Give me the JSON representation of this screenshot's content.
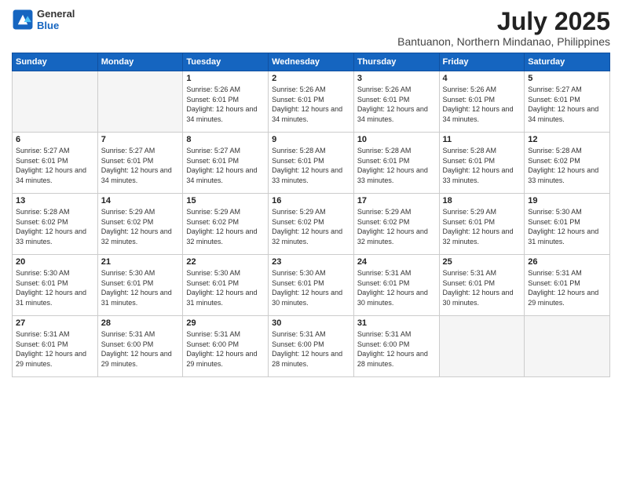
{
  "logo": {
    "general": "General",
    "blue": "Blue"
  },
  "title": "July 2025",
  "location": "Bantuanon, Northern Mindanao, Philippines",
  "weekdays": [
    "Sunday",
    "Monday",
    "Tuesday",
    "Wednesday",
    "Thursday",
    "Friday",
    "Saturday"
  ],
  "weeks": [
    [
      {
        "day": "",
        "sunrise": "",
        "sunset": "",
        "daylight": ""
      },
      {
        "day": "",
        "sunrise": "",
        "sunset": "",
        "daylight": ""
      },
      {
        "day": "1",
        "sunrise": "Sunrise: 5:26 AM",
        "sunset": "Sunset: 6:01 PM",
        "daylight": "Daylight: 12 hours and 34 minutes."
      },
      {
        "day": "2",
        "sunrise": "Sunrise: 5:26 AM",
        "sunset": "Sunset: 6:01 PM",
        "daylight": "Daylight: 12 hours and 34 minutes."
      },
      {
        "day": "3",
        "sunrise": "Sunrise: 5:26 AM",
        "sunset": "Sunset: 6:01 PM",
        "daylight": "Daylight: 12 hours and 34 minutes."
      },
      {
        "day": "4",
        "sunrise": "Sunrise: 5:26 AM",
        "sunset": "Sunset: 6:01 PM",
        "daylight": "Daylight: 12 hours and 34 minutes."
      },
      {
        "day": "5",
        "sunrise": "Sunrise: 5:27 AM",
        "sunset": "Sunset: 6:01 PM",
        "daylight": "Daylight: 12 hours and 34 minutes."
      }
    ],
    [
      {
        "day": "6",
        "sunrise": "Sunrise: 5:27 AM",
        "sunset": "Sunset: 6:01 PM",
        "daylight": "Daylight: 12 hours and 34 minutes."
      },
      {
        "day": "7",
        "sunrise": "Sunrise: 5:27 AM",
        "sunset": "Sunset: 6:01 PM",
        "daylight": "Daylight: 12 hours and 34 minutes."
      },
      {
        "day": "8",
        "sunrise": "Sunrise: 5:27 AM",
        "sunset": "Sunset: 6:01 PM",
        "daylight": "Daylight: 12 hours and 34 minutes."
      },
      {
        "day": "9",
        "sunrise": "Sunrise: 5:28 AM",
        "sunset": "Sunset: 6:01 PM",
        "daylight": "Daylight: 12 hours and 33 minutes."
      },
      {
        "day": "10",
        "sunrise": "Sunrise: 5:28 AM",
        "sunset": "Sunset: 6:01 PM",
        "daylight": "Daylight: 12 hours and 33 minutes."
      },
      {
        "day": "11",
        "sunrise": "Sunrise: 5:28 AM",
        "sunset": "Sunset: 6:01 PM",
        "daylight": "Daylight: 12 hours and 33 minutes."
      },
      {
        "day": "12",
        "sunrise": "Sunrise: 5:28 AM",
        "sunset": "Sunset: 6:02 PM",
        "daylight": "Daylight: 12 hours and 33 minutes."
      }
    ],
    [
      {
        "day": "13",
        "sunrise": "Sunrise: 5:28 AM",
        "sunset": "Sunset: 6:02 PM",
        "daylight": "Daylight: 12 hours and 33 minutes."
      },
      {
        "day": "14",
        "sunrise": "Sunrise: 5:29 AM",
        "sunset": "Sunset: 6:02 PM",
        "daylight": "Daylight: 12 hours and 32 minutes."
      },
      {
        "day": "15",
        "sunrise": "Sunrise: 5:29 AM",
        "sunset": "Sunset: 6:02 PM",
        "daylight": "Daylight: 12 hours and 32 minutes."
      },
      {
        "day": "16",
        "sunrise": "Sunrise: 5:29 AM",
        "sunset": "Sunset: 6:02 PM",
        "daylight": "Daylight: 12 hours and 32 minutes."
      },
      {
        "day": "17",
        "sunrise": "Sunrise: 5:29 AM",
        "sunset": "Sunset: 6:02 PM",
        "daylight": "Daylight: 12 hours and 32 minutes."
      },
      {
        "day": "18",
        "sunrise": "Sunrise: 5:29 AM",
        "sunset": "Sunset: 6:01 PM",
        "daylight": "Daylight: 12 hours and 32 minutes."
      },
      {
        "day": "19",
        "sunrise": "Sunrise: 5:30 AM",
        "sunset": "Sunset: 6:01 PM",
        "daylight": "Daylight: 12 hours and 31 minutes."
      }
    ],
    [
      {
        "day": "20",
        "sunrise": "Sunrise: 5:30 AM",
        "sunset": "Sunset: 6:01 PM",
        "daylight": "Daylight: 12 hours and 31 minutes."
      },
      {
        "day": "21",
        "sunrise": "Sunrise: 5:30 AM",
        "sunset": "Sunset: 6:01 PM",
        "daylight": "Daylight: 12 hours and 31 minutes."
      },
      {
        "day": "22",
        "sunrise": "Sunrise: 5:30 AM",
        "sunset": "Sunset: 6:01 PM",
        "daylight": "Daylight: 12 hours and 31 minutes."
      },
      {
        "day": "23",
        "sunrise": "Sunrise: 5:30 AM",
        "sunset": "Sunset: 6:01 PM",
        "daylight": "Daylight: 12 hours and 30 minutes."
      },
      {
        "day": "24",
        "sunrise": "Sunrise: 5:31 AM",
        "sunset": "Sunset: 6:01 PM",
        "daylight": "Daylight: 12 hours and 30 minutes."
      },
      {
        "day": "25",
        "sunrise": "Sunrise: 5:31 AM",
        "sunset": "Sunset: 6:01 PM",
        "daylight": "Daylight: 12 hours and 30 minutes."
      },
      {
        "day": "26",
        "sunrise": "Sunrise: 5:31 AM",
        "sunset": "Sunset: 6:01 PM",
        "daylight": "Daylight: 12 hours and 29 minutes."
      }
    ],
    [
      {
        "day": "27",
        "sunrise": "Sunrise: 5:31 AM",
        "sunset": "Sunset: 6:01 PM",
        "daylight": "Daylight: 12 hours and 29 minutes."
      },
      {
        "day": "28",
        "sunrise": "Sunrise: 5:31 AM",
        "sunset": "Sunset: 6:00 PM",
        "daylight": "Daylight: 12 hours and 29 minutes."
      },
      {
        "day": "29",
        "sunrise": "Sunrise: 5:31 AM",
        "sunset": "Sunset: 6:00 PM",
        "daylight": "Daylight: 12 hours and 29 minutes."
      },
      {
        "day": "30",
        "sunrise": "Sunrise: 5:31 AM",
        "sunset": "Sunset: 6:00 PM",
        "daylight": "Daylight: 12 hours and 28 minutes."
      },
      {
        "day": "31",
        "sunrise": "Sunrise: 5:31 AM",
        "sunset": "Sunset: 6:00 PM",
        "daylight": "Daylight: 12 hours and 28 minutes."
      },
      {
        "day": "",
        "sunrise": "",
        "sunset": "",
        "daylight": ""
      },
      {
        "day": "",
        "sunrise": "",
        "sunset": "",
        "daylight": ""
      }
    ]
  ]
}
